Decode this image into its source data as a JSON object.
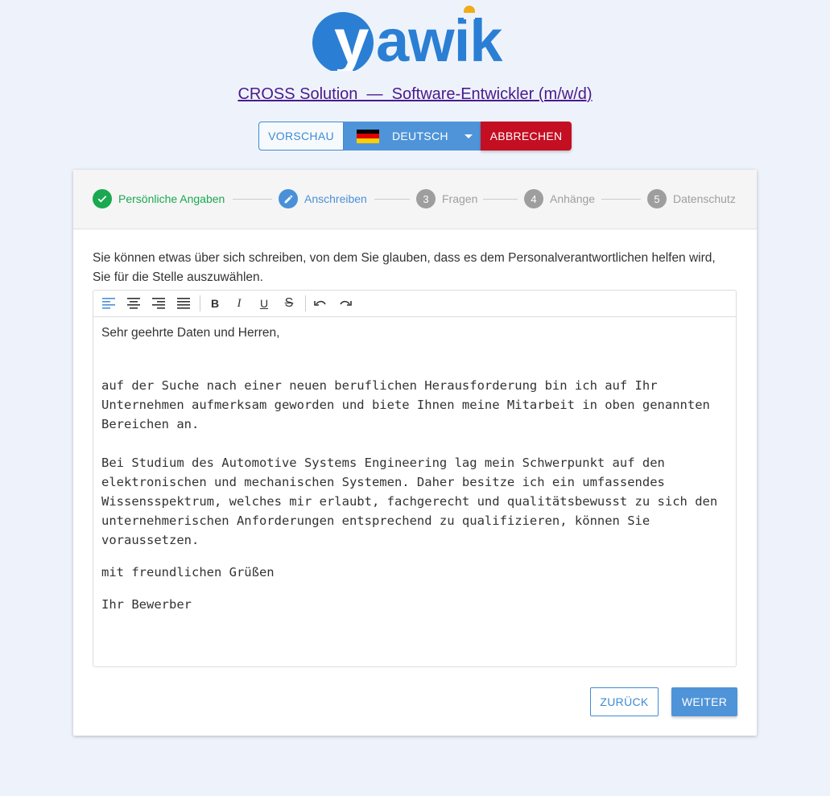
{
  "logo": {
    "text": "yawik",
    "primary_color": "#2a7fd4",
    "dot_color": "#f0ad1a"
  },
  "job": {
    "title": "CROSS Solution  —  Software-Entwickler (m/w/d)"
  },
  "header_buttons": {
    "preview_label": "VORSCHAU",
    "language_label": "DEUTSCH",
    "language_flag": "flag-de-icon",
    "cancel_label": "ABBRECHEN"
  },
  "stepper": {
    "steps": [
      {
        "number": "1",
        "label": "Persönliche Angaben",
        "state": "completed",
        "icon": "check-icon"
      },
      {
        "number": "2",
        "label": "Anschreiben",
        "state": "active",
        "icon": "pencil-icon"
      },
      {
        "number": "3",
        "label": "Fragen",
        "state": "pending"
      },
      {
        "number": "4",
        "label": "Anhänge",
        "state": "pending"
      },
      {
        "number": "5",
        "label": "Datenschutz",
        "state": "pending"
      }
    ]
  },
  "form": {
    "intro": "Sie können etwas über sich schreiben, von dem Sie glauben, dass es dem Personalverantwortlichen helfen wird, Sie für die Stelle auszuwählen.",
    "toolbar": [
      "align-left-icon",
      "align-center-icon",
      "align-right-icon",
      "align-justify-icon",
      "bold-icon",
      "italic-icon",
      "underline-icon",
      "strikethrough-icon",
      "undo-icon",
      "redo-icon"
    ],
    "letter": {
      "greeting": "Sehr geehrte Daten und Herren,",
      "paragraph1": "auf der Suche nach einer neuen beruflichen Herausforderung bin ich auf Ihr Unternehmen aufmerksam geworden und biete Ihnen meine Mitarbeit in oben genannten Bereichen an.",
      "paragraph2": "Bei Studium des Automotive Systems Engineering lag mein Schwerpunkt auf den elektronischen und mechanischen Systemen. Daher besitze ich ein umfassendes Wissensspektrum, welches mir erlaubt, fachgerecht und qualitätsbewusst zu sich den unternehmerischen Anforderungen entsprechend zu qualifizieren, können Sie voraussetzen.",
      "closing": "mit freundlichen Grüßen",
      "signature": "Ihr Bewerber"
    },
    "back_label": "ZURÜCK",
    "next_label": "WEITER"
  },
  "colors": {
    "completed": "#1aa851",
    "active": "#4a90d9",
    "pending": "#9e9e9e",
    "cancel": "#c40f23"
  }
}
